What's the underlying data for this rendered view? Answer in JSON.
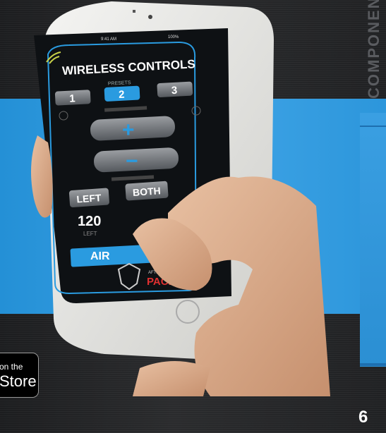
{
  "page": {
    "section_title": "COMPONENTS",
    "page_number": "6"
  },
  "badge": {
    "line1": "on the",
    "line2": "Store"
  },
  "status_bar": {
    "time": "9:41 AM",
    "battery": "100%"
  },
  "app": {
    "title": "WIRELESS CONTROLS",
    "presets_label": "PRESETS",
    "presets": [
      "1",
      "2",
      "3"
    ],
    "selected_preset": "2",
    "plus_symbol": "+",
    "minus_symbol": "−",
    "side_buttons": [
      "LEFT",
      "BOTH"
    ],
    "pressure_value": "120",
    "pressure_label": "LEFT",
    "air_button": "AIR",
    "brand_small": "AFTERMARKET BY",
    "brand_name": "PACBRAKE"
  },
  "colors": {
    "accent": "#2a9be0",
    "blue_band": "#3fa4e6",
    "panel_bg": "#0e1114"
  }
}
